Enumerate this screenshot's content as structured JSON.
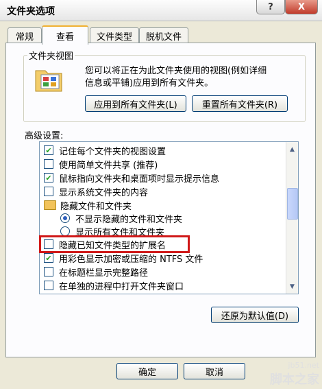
{
  "window": {
    "title": "文件夹选项",
    "help_label": "?",
    "close_label": "X"
  },
  "tabs": [
    {
      "label": "常规"
    },
    {
      "label": "查看",
      "active": true
    },
    {
      "label": "文件类型"
    },
    {
      "label": "脱机文件"
    }
  ],
  "folder_view": {
    "legend": "文件夹视图",
    "description_line1": "您可以将正在为此文件夹使用的视图(例如详细",
    "description_line2": "信息或平铺)应用到所有文件夹。",
    "apply_all_label": "应用到所有文件夹(L)",
    "reset_all_label": "重置所有文件夹(R)"
  },
  "advanced": {
    "label": "高级设置:",
    "items": [
      {
        "type": "checkbox",
        "checked": true,
        "label": "记住每个文件夹的视图设置"
      },
      {
        "type": "checkbox",
        "checked": false,
        "label": "使用简单文件共享 (推荐)"
      },
      {
        "type": "checkbox",
        "checked": true,
        "label": "鼠标指向文件夹和桌面项时显示提示信息"
      },
      {
        "type": "checkbox",
        "checked": false,
        "label": "显示系统文件夹的内容"
      },
      {
        "type": "folder",
        "label": "隐藏文件和文件夹"
      },
      {
        "type": "radio",
        "checked": true,
        "label": "不显示隐藏的文件和文件夹"
      },
      {
        "type": "radio",
        "checked": false,
        "label": "显示所有文件和文件夹"
      },
      {
        "type": "checkbox",
        "checked": false,
        "label": "隐藏已知文件类型的扩展名"
      },
      {
        "type": "checkbox",
        "checked": true,
        "label": "用彩色显示加密或压缩的 NTFS 文件"
      },
      {
        "type": "checkbox",
        "checked": false,
        "label": "在标题栏显示完整路径"
      },
      {
        "type": "checkbox",
        "checked": false,
        "label": "在单独的进程中打开文件夹窗口"
      }
    ],
    "restore_defaults_label": "还原为默认值(D)"
  },
  "footer": {
    "ok_label": "确定",
    "cancel_label": "取消"
  },
  "watermark": {
    "line1": "jb51.net",
    "line2": "脚本之家"
  },
  "colors": {
    "highlight_box": "#d01818",
    "check_green": "#21a121",
    "dialog_bg": "#ece9d8"
  }
}
